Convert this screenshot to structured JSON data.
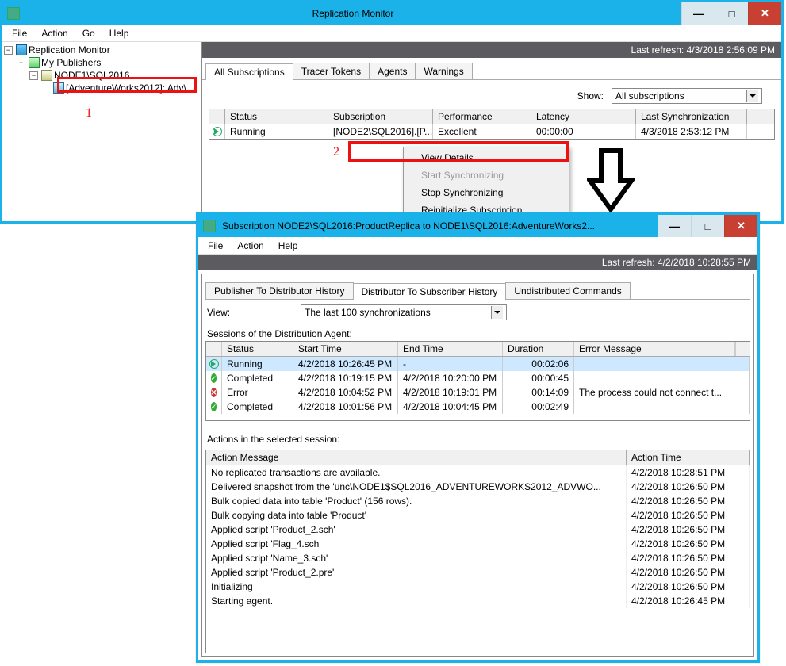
{
  "win1": {
    "title": "Replication Monitor",
    "menu": [
      "File",
      "Action",
      "Go",
      "Help"
    ],
    "refresh": "Last refresh: 4/3/2018 2:56:09 PM",
    "tree": {
      "root": "Replication Monitor",
      "pub": "My Publishers",
      "node": "NODE1\\SQL2016",
      "db": "[AdventureWorks2012]: Adv\\"
    },
    "tabs": [
      "All Subscriptions",
      "Tracer Tokens",
      "Agents",
      "Warnings"
    ],
    "show_label": "Show:",
    "show_value": "All subscriptions",
    "grid_headers": {
      "status": "Status",
      "subscription": "Subscription",
      "performance": "Performance",
      "latency": "Latency",
      "last_sync": "Last Synchronization"
    },
    "grid_row": {
      "status": "Running",
      "subscription": "[NODE2\\SQL2016].[P...",
      "performance": "Excellent",
      "latency": "00:00:00",
      "last_sync": "4/3/2018 2:53:12 PM"
    },
    "ctx": {
      "view_details": "View Details",
      "start_sync": "Start Synchronizing",
      "stop_sync": "Stop Synchronizing",
      "reinit": "Reinitialize Subscription"
    }
  },
  "anno": {
    "one": "1",
    "two": "2"
  },
  "win2": {
    "title": "Subscription NODE2\\SQL2016:ProductReplica to NODE1\\SQL2016:AdventureWorks2...",
    "menu": [
      "File",
      "Action",
      "Help"
    ],
    "refresh": "Last refresh: 4/2/2018 10:28:55 PM",
    "tabs": [
      "Publisher To Distributor History",
      "Distributor To Subscriber History",
      "Undistributed Commands"
    ],
    "view_label": "View:",
    "view_value": "The last 100 synchronizations",
    "sessions_label": "Sessions of the Distribution Agent:",
    "sess_headers": {
      "status": "Status",
      "start": "Start Time",
      "end": "End Time",
      "duration": "Duration",
      "err": "Error Message"
    },
    "sessions": [
      {
        "icon": "run",
        "status": "Running",
        "start": "4/2/2018 10:26:45 PM",
        "end": "-",
        "duration": "00:02:06",
        "err": ""
      },
      {
        "icon": "ok",
        "status": "Completed",
        "start": "4/2/2018 10:19:15 PM",
        "end": "4/2/2018 10:20:00 PM",
        "duration": "00:00:45",
        "err": ""
      },
      {
        "icon": "err",
        "status": "Error",
        "start": "4/2/2018 10:04:52 PM",
        "end": "4/2/2018 10:19:01 PM",
        "duration": "00:14:09",
        "err": "The process could not connect t..."
      },
      {
        "icon": "ok",
        "status": "Completed",
        "start": "4/2/2018 10:01:56 PM",
        "end": "4/2/2018 10:04:45 PM",
        "duration": "00:02:49",
        "err": ""
      }
    ],
    "actions_label": "Actions in the selected session:",
    "act_headers": {
      "msg": "Action Message",
      "time": "Action Time"
    },
    "actions": [
      {
        "msg": "No replicated transactions are available.",
        "time": "4/2/2018 10:28:51 PM"
      },
      {
        "msg": "Delivered snapshot from the 'unc\\NODE1$SQL2016_ADVENTUREWORKS2012_ADVWO...",
        "time": "4/2/2018 10:26:50 PM"
      },
      {
        "msg": "Bulk copied data into table 'Product' (156 rows).",
        "time": "4/2/2018 10:26:50 PM"
      },
      {
        "msg": "Bulk copying data into table 'Product'",
        "time": "4/2/2018 10:26:50 PM"
      },
      {
        "msg": "Applied script 'Product_2.sch'",
        "time": "4/2/2018 10:26:50 PM"
      },
      {
        "msg": "Applied script 'Flag_4.sch'",
        "time": "4/2/2018 10:26:50 PM"
      },
      {
        "msg": "Applied script 'Name_3.sch'",
        "time": "4/2/2018 10:26:50 PM"
      },
      {
        "msg": "Applied script 'Product_2.pre'",
        "time": "4/2/2018 10:26:50 PM"
      },
      {
        "msg": "Initializing",
        "time": "4/2/2018 10:26:50 PM"
      },
      {
        "msg": "Starting agent.",
        "time": "4/2/2018 10:26:45 PM"
      }
    ]
  }
}
